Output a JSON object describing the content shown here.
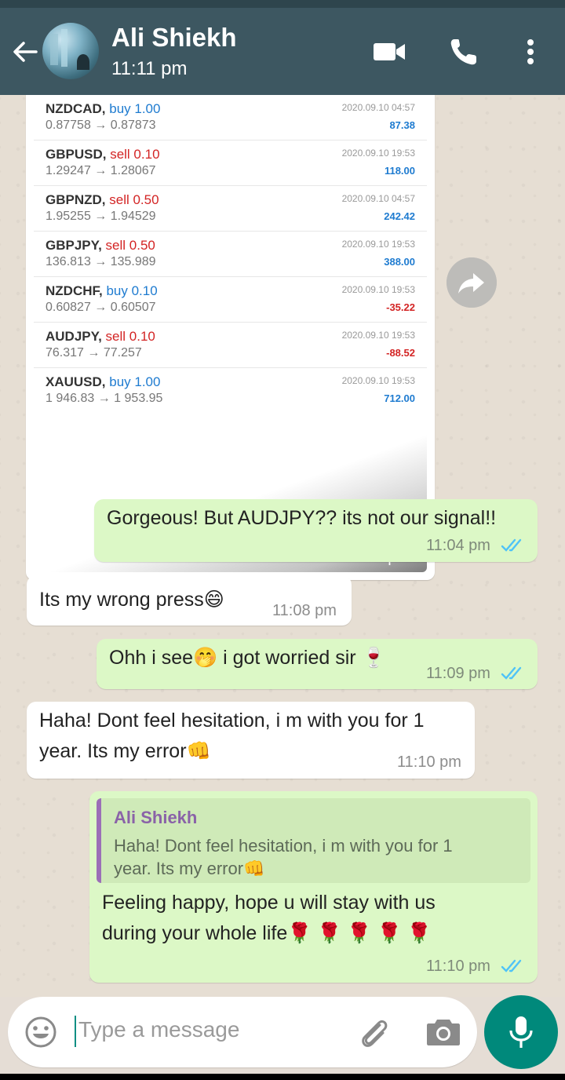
{
  "header": {
    "contact_name": "Ali Shiekh",
    "status_time": "11:11 pm"
  },
  "image_message": {
    "trades": [
      {
        "symbol": "NZDCAD,",
        "side": "buy 1.00",
        "side_type": "buy",
        "prices": "0.87758 → 0.87873",
        "date": "2020.09.10 04:57",
        "pnl": "87.38",
        "pnl_sign": "pos"
      },
      {
        "symbol": "GBPUSD,",
        "side": "sell 0.10",
        "side_type": "sell",
        "prices": "1.29247 → 1.28067",
        "date": "2020.09.10 19:53",
        "pnl": "118.00",
        "pnl_sign": "pos"
      },
      {
        "symbol": "GBPNZD,",
        "side": "sell 0.50",
        "side_type": "sell",
        "prices": "1.95255 → 1.94529",
        "date": "2020.09.10 04:57",
        "pnl": "242.42",
        "pnl_sign": "pos"
      },
      {
        "symbol": "GBPJPY,",
        "side": "sell 0.50",
        "side_type": "sell",
        "prices": "136.813 → 135.989",
        "date": "2020.09.10 19:53",
        "pnl": "388.00",
        "pnl_sign": "pos"
      },
      {
        "symbol": "NZDCHF,",
        "side": "buy 0.10",
        "side_type": "buy",
        "prices": "0.60827 → 0.60507",
        "date": "2020.09.10 19:53",
        "pnl": "-35.22",
        "pnl_sign": "neg"
      },
      {
        "symbol": "AUDJPY,",
        "side": "sell 0.10",
        "side_type": "sell",
        "prices": "76.317 → 77.257",
        "date": "2020.09.10 19:53",
        "pnl": "-88.52",
        "pnl_sign": "neg"
      },
      {
        "symbol": "XAUUSD,",
        "side": "buy 1.00",
        "side_type": "buy",
        "prices": "1 946.83 → 1 953.95",
        "date": "2020.09.10 19:53",
        "pnl": "712.00",
        "pnl_sign": "pos"
      }
    ],
    "time": "11:03 pm"
  },
  "messages": {
    "m1": {
      "text": "Gorgeous! But AUDJPY?? its not our signal!!",
      "time": "11:04 pm"
    },
    "m2": {
      "text": "Its my wrong press",
      "emoji": "😄",
      "time": "11:08 pm"
    },
    "m3": {
      "text_a": "Ohh i see",
      "emoji_a": "🤭",
      "text_b": " i got worried sir ",
      "emoji_b": "🍷",
      "time": "11:09 pm"
    },
    "m4": {
      "line1": "Haha! Dont feel hesitation, i m with you for 1",
      "line2": "year. Its my error",
      "emoji": "👊",
      "time": "11:10 pm"
    },
    "m5": {
      "quote_name": "Ali Shiekh",
      "quote_line1": "Haha! Dont feel hesitation, i m with you for 1",
      "quote_line2": "year. Its my error",
      "quote_emoji": "👊",
      "line1": "Feeling happy, hope u will stay with us",
      "line2": "during your whole life",
      "emoji": "🌹 🌹 🌹 🌹 🌹",
      "time": "11:10 pm"
    }
  },
  "composer": {
    "placeholder": "Type a message"
  },
  "colors": {
    "header": "#3d5761",
    "outgoing_bubble": "#dcf8c6",
    "incoming_bubble": "#ffffff",
    "mic_button": "#00897b",
    "read_ticks": "#4fc3f7"
  },
  "icons": [
    "back-arrow-icon",
    "video-call-icon",
    "voice-call-icon",
    "more-options-icon",
    "forward-icon",
    "double-check-icon",
    "emoji-icon",
    "attach-icon",
    "camera-icon",
    "mic-icon"
  ]
}
